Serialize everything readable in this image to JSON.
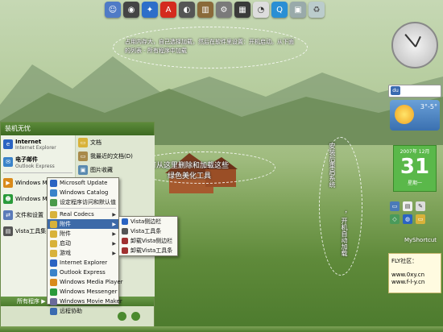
{
  "annotations": {
    "top": "占用内存大，自己选择加载，然后在软件里设置：开机启动。从下面的列表 - 所有程序中加载",
    "middle_line1": "可从这里删除和加载这些",
    "middle_line2": "绿色美化工具",
    "vertical_a": "安装后重启系统",
    "vertical_b": "，开机自动加载"
  },
  "start_panel": {
    "title": "装机无忧",
    "pinned": [
      {
        "title": "Internet",
        "sub": "Internet Explorer",
        "icon": "ie-icon",
        "color": "#2b64c2"
      },
      {
        "title": "电子邮件",
        "sub": "Outlook Express",
        "icon": "mail-icon",
        "color": "#3a83c9"
      }
    ],
    "left_items": [
      {
        "label": "Windows Me",
        "icon": "media-player-icon",
        "color": "#d98a1a"
      },
      {
        "label": "Windows Me",
        "icon": "messenger-icon",
        "color": "#2a9a3a"
      },
      {
        "label": "文件和设置",
        "icon": "transfer-icon",
        "color": "#5a7ab8"
      },
      {
        "label": "Vista工具集",
        "icon": "tools-icon",
        "color": "#555"
      }
    ],
    "right_items": [
      {
        "label": "文档",
        "icon": "folder-icon"
      },
      {
        "label": "我最近的文档(D)",
        "icon": "recent-docs-icon"
      },
      {
        "label": "图片收藏",
        "icon": "pictures-icon"
      }
    ],
    "all_programs": "所有程序"
  },
  "programs_menu": [
    {
      "label": "Microsoft Update",
      "icon": "update-icon",
      "color": "#2b64c2"
    },
    {
      "label": "Windows Catalog",
      "icon": "catalog-icon",
      "color": "#3a83c9"
    },
    {
      "label": "设定程序访问和默认值",
      "icon": "defaults-icon",
      "color": "#4a9a4a"
    },
    {
      "sep": true
    },
    {
      "label": "Real Codecs",
      "icon": "folder-icon",
      "color": "#d8b23a",
      "arrow": true
    },
    {
      "label": "附件",
      "icon": "folder-icon",
      "color": "#d8b23a",
      "arrow": true,
      "highlight": true
    },
    {
      "label": "附件",
      "icon": "folder-icon",
      "color": "#d8b23a",
      "arrow": true
    },
    {
      "label": "启动",
      "icon": "folder-icon",
      "color": "#d8b23a",
      "arrow": true
    },
    {
      "label": "游戏",
      "icon": "folder-icon",
      "color": "#d8b23a",
      "arrow": true
    },
    {
      "label": "Internet Explorer",
      "icon": "ie-icon",
      "color": "#2b64c2"
    },
    {
      "label": "Outlook Express",
      "icon": "mail-icon",
      "color": "#3a83c9"
    },
    {
      "label": "Windows Media Player",
      "icon": "media-player-icon",
      "color": "#d98a1a"
    },
    {
      "label": "Windows Messenger",
      "icon": "messenger-icon",
      "color": "#2a9a3a"
    },
    {
      "label": "Windows Movie Maker",
      "icon": "movie-icon",
      "color": "#6a6a9a"
    },
    {
      "label": "远程协助",
      "icon": "remote-icon",
      "color": "#3a6ab0"
    }
  ],
  "submenu": [
    {
      "label": "Vista侧边栏",
      "icon": "sidebar-icon",
      "color": "#2b64c2"
    },
    {
      "label": "Vista工具条",
      "icon": "toolbar-icon",
      "color": "#555"
    },
    {
      "label": "卸载Vista侧边栏",
      "icon": "uninstall-icon",
      "color": "#a03030"
    },
    {
      "label": "卸载Vista工具条",
      "icon": "uninstall-icon",
      "color": "#a03030"
    }
  ],
  "gadgets": {
    "search_placeholder": "",
    "weather_temp": "3°-5°",
    "cal_header": "2007年 12月",
    "cal_day": "31",
    "cal_week": "星期一",
    "shortcut_label": "MyShortcut",
    "note_title": "FLY社区：",
    "note_line1": "www.0xy.cn",
    "note_line2": "www.f-l-y.cn"
  },
  "dock_icons": [
    "finder-icon",
    "dashboard-icon",
    "safari-icon",
    "pdf-icon",
    "quicktime-icon",
    "book-icon",
    "system-prefs-icon",
    "calculator-icon",
    "clock-icon",
    "quicktime-q-icon",
    "preview-icon",
    "trash-icon"
  ]
}
